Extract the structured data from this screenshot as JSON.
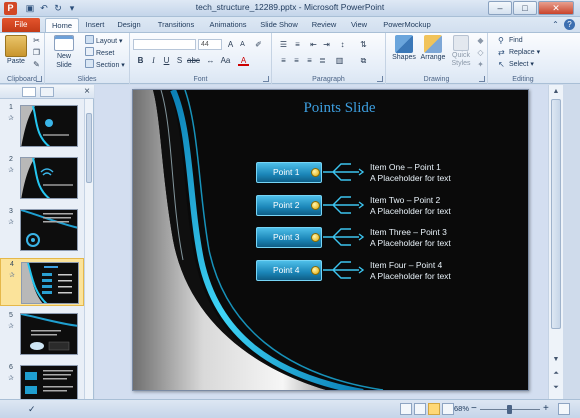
{
  "window": {
    "title": "tech_structure_12289.pptx - Microsoft PowerPoint",
    "minimize": "–",
    "maximize": "□",
    "close": "✕"
  },
  "tabs": {
    "file": "File",
    "items": [
      "Home",
      "Insert",
      "Design",
      "Transitions",
      "Animations",
      "Slide Show",
      "Review",
      "View",
      "PowerMockup"
    ]
  },
  "ribbon": {
    "clipboard": {
      "label": "Clipboard",
      "paste": "Paste"
    },
    "slides": {
      "label": "Slides",
      "new_slide": "New Slide",
      "layout": "Layout",
      "reset": "Reset",
      "section": "Section"
    },
    "font": {
      "label": "Font",
      "size": "44"
    },
    "paragraph": {
      "label": "Paragraph"
    },
    "drawing": {
      "label": "Drawing",
      "shapes": "Shapes",
      "arrange": "Arrange",
      "quick_styles": "Quick Styles"
    },
    "editing": {
      "label": "Editing",
      "find": "Find",
      "replace": "Replace",
      "select": "Select"
    }
  },
  "thumbnails": [
    "1",
    "2",
    "3",
    "4",
    "5",
    "6"
  ],
  "selected_thumbnail": "4",
  "slide": {
    "title": "Points Slide",
    "points": [
      {
        "button": "Point 1",
        "line1": "Item One – Point 1",
        "line2": "A Placeholder for text"
      },
      {
        "button": "Point 2",
        "line1": "Item Two – Point 2",
        "line2": "A Placeholder for text"
      },
      {
        "button": "Point 3",
        "line1": "Item Three – Point 3",
        "line2": "A Placeholder for text"
      },
      {
        "button": "Point 4",
        "line1": "Item Four – Point 4",
        "line2": "A Placeholder for text"
      }
    ]
  },
  "status": {
    "zoom": "68%",
    "zoom_minus": "−",
    "zoom_plus": "+"
  },
  "colors": {
    "file_tab": "#d24726",
    "accent_blue": "#1b86b8",
    "slide_title": "#3d9fe0"
  }
}
